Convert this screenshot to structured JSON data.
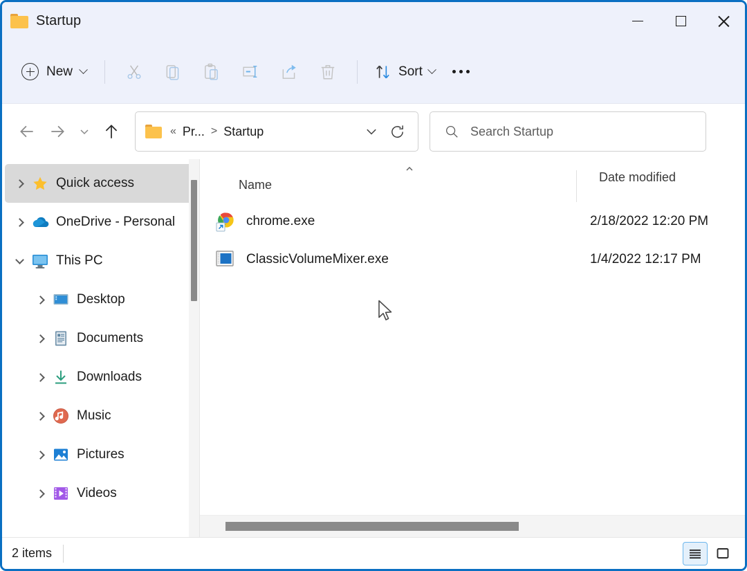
{
  "window": {
    "title": "Startup",
    "folder_icon": "folder-icon",
    "controls": {
      "minimize": "Minimize",
      "maximize": "Maximize",
      "close": "Close"
    }
  },
  "toolbar": {
    "new_label": "New",
    "new_icon": "plus-circle-icon",
    "new_chevron": "chevron-down-icon",
    "items": [
      {
        "name": "cut-button",
        "icon": "scissors-icon",
        "label": "Cut"
      },
      {
        "name": "copy-button",
        "icon": "copy-icon",
        "label": "Copy"
      },
      {
        "name": "paste-button",
        "icon": "clipboard-icon",
        "label": "Paste"
      },
      {
        "name": "rename-button",
        "icon": "rename-icon",
        "label": "Rename"
      },
      {
        "name": "share-button",
        "icon": "share-icon",
        "label": "Share"
      },
      {
        "name": "delete-button",
        "icon": "trash-icon",
        "label": "Delete"
      }
    ],
    "sort_label": "Sort",
    "sort_icon": "sort-arrows-icon",
    "overflow_label": "See more"
  },
  "navigation": {
    "back": "Back",
    "forward": "Forward",
    "recent": "Recent locations",
    "up": "Up to Programs"
  },
  "address": {
    "folder_icon": "folder-icon",
    "crumbs": [
      {
        "label": "«",
        "type": "overflow"
      },
      {
        "label": "Pr...",
        "type": "crumb"
      },
      {
        "label": ">",
        "type": "sep"
      },
      {
        "label": "Startup",
        "type": "crumb"
      }
    ],
    "dropdown_icon": "chevron-down-icon",
    "refresh_icon": "refresh-icon"
  },
  "search": {
    "icon": "search-icon",
    "placeholder": "Search Startup"
  },
  "sidebar": {
    "items": [
      {
        "label": "Quick access",
        "icon": "star-icon",
        "expanded": false,
        "selected": true,
        "indent": false
      },
      {
        "label": "OneDrive - Personal",
        "icon": "cloud-icon",
        "expanded": false,
        "selected": false,
        "indent": false
      },
      {
        "label": "This PC",
        "icon": "monitor-icon",
        "expanded": true,
        "selected": false,
        "indent": false
      },
      {
        "label": "Desktop",
        "icon": "desktop-icon",
        "expanded": false,
        "selected": false,
        "indent": true
      },
      {
        "label": "Documents",
        "icon": "documents-icon",
        "expanded": false,
        "selected": false,
        "indent": true
      },
      {
        "label": "Downloads",
        "icon": "download-icon",
        "expanded": false,
        "selected": false,
        "indent": true
      },
      {
        "label": "Music",
        "icon": "music-icon",
        "expanded": false,
        "selected": false,
        "indent": true
      },
      {
        "label": "Pictures",
        "icon": "pictures-icon",
        "expanded": false,
        "selected": false,
        "indent": true
      },
      {
        "label": "Videos",
        "icon": "videos-icon",
        "expanded": false,
        "selected": false,
        "indent": true
      }
    ]
  },
  "file_list": {
    "columns": [
      {
        "label": "Name",
        "sort": "ascending"
      },
      {
        "label": "Date modified",
        "sort": "none"
      }
    ],
    "rows": [
      {
        "name": "chrome.exe",
        "date": "2/18/2022 12:20 PM",
        "icon": "chrome-shortcut-icon"
      },
      {
        "name": "ClassicVolumeMixer.exe",
        "date": "1/4/2022 12:17 PM",
        "icon": "application-icon"
      }
    ]
  },
  "status": {
    "item_count": "2 items",
    "views": [
      {
        "name": "details-view-button",
        "icon": "list-lines-icon",
        "active": true
      },
      {
        "name": "large-icons-view-button",
        "icon": "large-icon-view-icon",
        "active": false
      }
    ]
  },
  "colors": {
    "window_border": "#0a6fc2",
    "titlebar": "#eef1fb",
    "accent": "#0078d4",
    "selected_row": "#d9d9d9",
    "scrollbar_thumb": "#8a8a8a"
  }
}
